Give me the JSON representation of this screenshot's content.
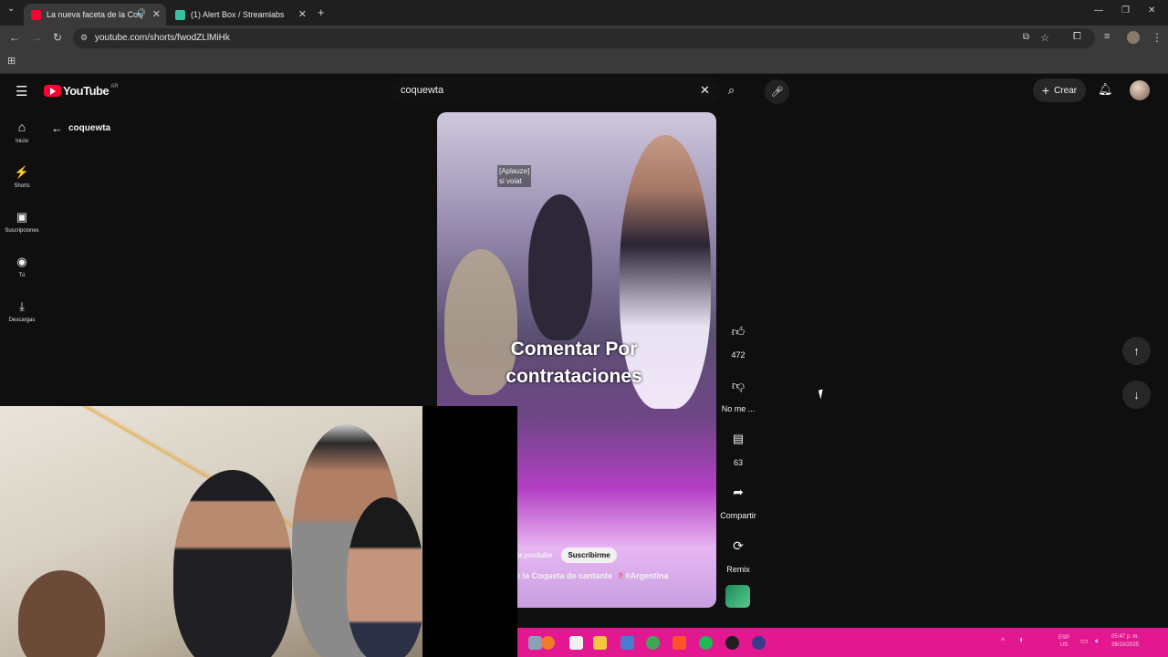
{
  "browser": {
    "tabs": [
      {
        "title": "La nueva faceta de la Coqu",
        "active": true,
        "favicon_color": "#ff0033"
      },
      {
        "title": "(1) Alert Box / Streamlabs",
        "active": false,
        "favicon_color": "#31c3a2"
      }
    ],
    "new_tab_label": "+",
    "url": "youtube.com/shorts/fwodZLlMiHk"
  },
  "youtube": {
    "logo_text": "YouTube",
    "region": "AR",
    "search_value": "coquewta",
    "create_label": "Crear",
    "back_title": "coquewta",
    "guide": [
      {
        "label": "Inicio",
        "icon": "home-icon"
      },
      {
        "label": "Shorts",
        "icon": "shorts-icon"
      },
      {
        "label": "Suscripciones",
        "icon": "subscriptions-icon"
      },
      {
        "label": "Tú",
        "icon": "you-icon"
      },
      {
        "label": "Descargas",
        "icon": "download-icon"
      }
    ],
    "short": {
      "caption_top": "[Aplauze]",
      "caption_top2": "si voiat",
      "overlay_text": "Comentar Por contrataciones",
      "channel": "ar.youtube",
      "subscribe_label": "Suscribirme",
      "title": "e la Coqueta de cantante",
      "hashtag": "#Argentina"
    },
    "actions": {
      "like_count": "472",
      "dislike_label": "No me ...",
      "comments_count": "63",
      "share_label": "Compartir",
      "remix_label": "Remix"
    }
  },
  "taskbar": {
    "lang_top": "ESP",
    "lang_bottom": "US",
    "time": "05:47 p. m.",
    "date": "28/10/2025"
  },
  "colors": {
    "youtube_red": "#ff0033",
    "taskbar": "#e3178f"
  }
}
